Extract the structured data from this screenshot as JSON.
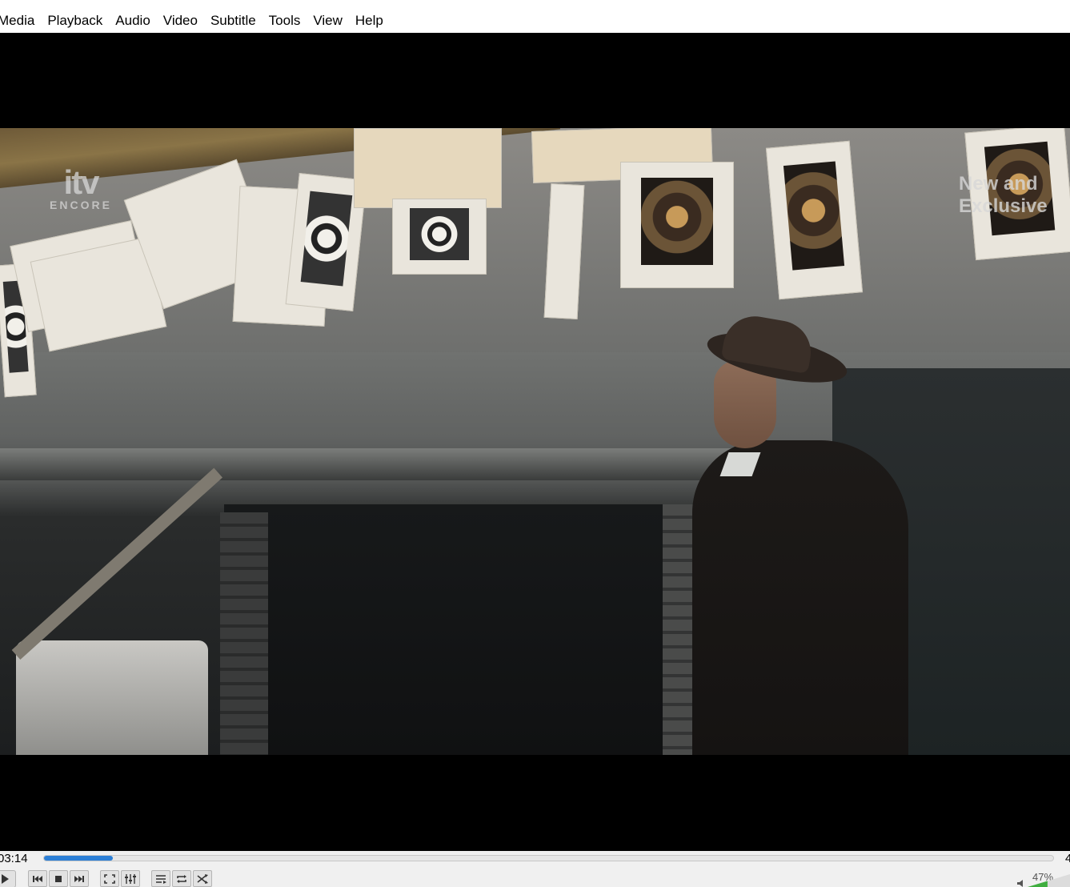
{
  "menu": [
    "Media",
    "Playback",
    "Audio",
    "Video",
    "Subtitle",
    "Tools",
    "View",
    "Help"
  ],
  "video": {
    "logo_main": "itv",
    "logo_sub": "ENCORE",
    "corner_line1": "New and",
    "corner_line2": "Exclusive"
  },
  "controls": {
    "time_elapsed": "03:14",
    "time_total": "4",
    "progress": 0.068,
    "volume_percent": "47%",
    "volume_level": 0.47,
    "accent_color": "#2c7fd6",
    "buttons": [
      {
        "name": "play-button",
        "icon": "play-icon"
      },
      {
        "name": "previous-button",
        "icon": "skip-back-icon"
      },
      {
        "name": "stop-button",
        "icon": "stop-icon"
      },
      {
        "name": "next-button",
        "icon": "skip-forward-icon"
      },
      {
        "name": "fullscreen-button",
        "icon": "fullscreen-icon"
      },
      {
        "name": "extended-settings-button",
        "icon": "equalizer-icon"
      },
      {
        "name": "playlist-button",
        "icon": "playlist-icon"
      },
      {
        "name": "loop-button",
        "icon": "loop-icon"
      },
      {
        "name": "shuffle-button",
        "icon": "shuffle-icon"
      }
    ]
  }
}
